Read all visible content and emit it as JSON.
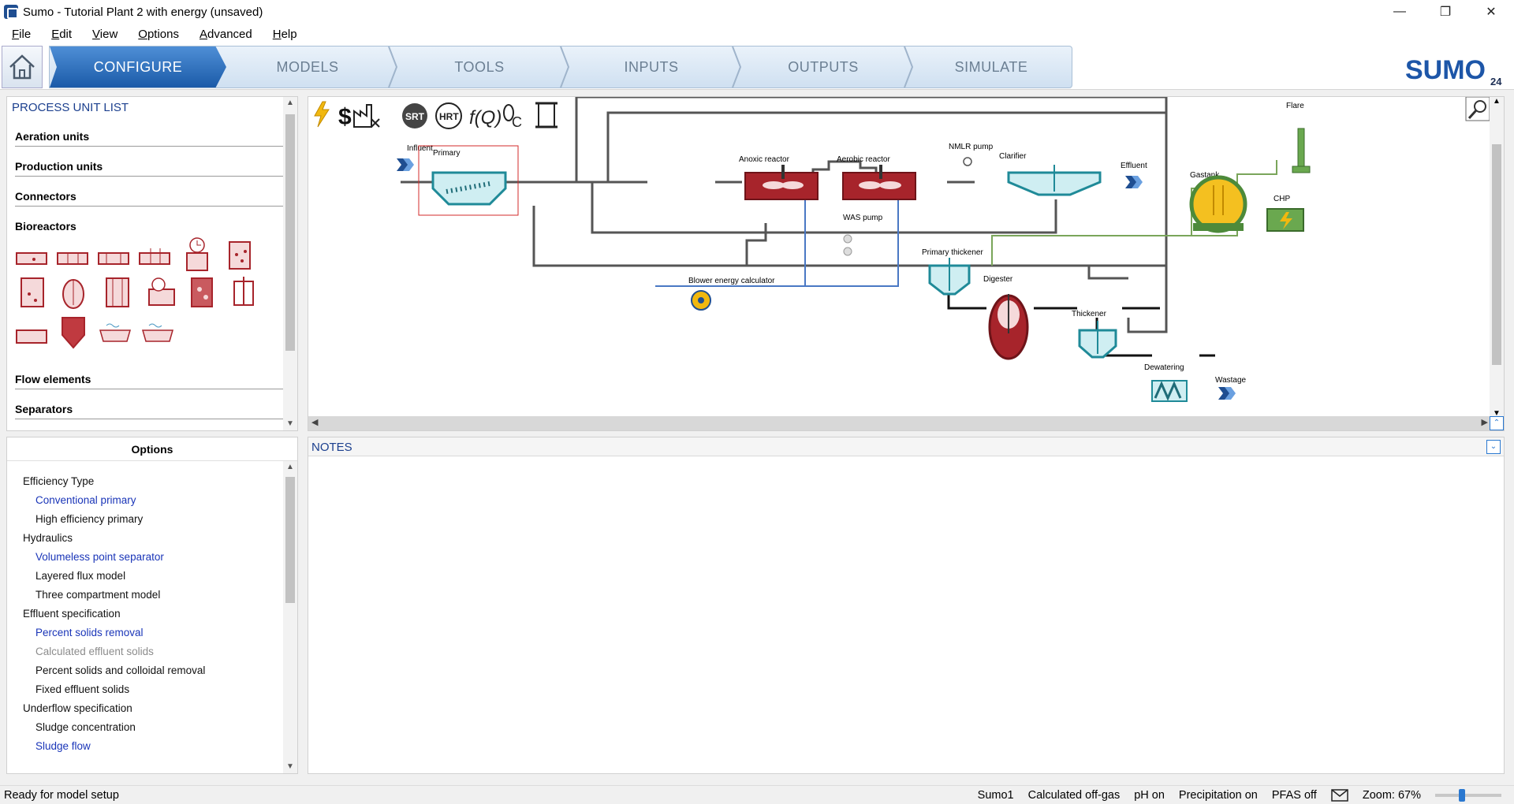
{
  "window": {
    "title": "Sumo - Tutorial Plant 2 with energy (unsaved)",
    "controls": [
      "—",
      "❐",
      "✕"
    ]
  },
  "menu": [
    "File",
    "Edit",
    "View",
    "Options",
    "Advanced",
    "Help"
  ],
  "tabs": [
    {
      "label": "CONFIGURE",
      "active": true
    },
    {
      "label": "MODELS",
      "active": false
    },
    {
      "label": "TOOLS",
      "active": false
    },
    {
      "label": "INPUTS",
      "active": false
    },
    {
      "label": "OUTPUTS",
      "active": false
    },
    {
      "label": "SIMULATE",
      "active": false
    }
  ],
  "logo": {
    "text": "SUMO",
    "version": "24"
  },
  "process_unit_list": {
    "title": "PROCESS UNIT LIST",
    "categories": [
      "Aeration units",
      "Production units",
      "Connectors",
      "Bioreactors",
      "Flow elements",
      "Separators"
    ]
  },
  "options": {
    "header": "Options",
    "items": [
      {
        "label": "Efficiency Type",
        "kind": "group"
      },
      {
        "label": "Conventional primary",
        "kind": "selected"
      },
      {
        "label": "High efficiency primary",
        "kind": "option"
      },
      {
        "label": "Hydraulics",
        "kind": "group"
      },
      {
        "label": "Volumeless point separator",
        "kind": "selected"
      },
      {
        "label": "Layered flux model",
        "kind": "option"
      },
      {
        "label": "Three compartment model",
        "kind": "option"
      },
      {
        "label": "Effluent specification",
        "kind": "group"
      },
      {
        "label": "Percent solids removal",
        "kind": "selected"
      },
      {
        "label": "Calculated effluent solids",
        "kind": "disabled"
      },
      {
        "label": "Percent solids and colloidal removal",
        "kind": "option"
      },
      {
        "label": "Fixed effluent solids",
        "kind": "option"
      },
      {
        "label": "Underflow specification",
        "kind": "group"
      },
      {
        "label": "Sludge concentration",
        "kind": "option"
      },
      {
        "label": "Sludge flow",
        "kind": "selected"
      }
    ]
  },
  "toolbar_icons": [
    "energy-icon",
    "cost-icon",
    "factory-icon",
    "srt-icon",
    "hrt-icon",
    "function-q-icon",
    "carbon-footprint-icon",
    "scroll-icon"
  ],
  "toolbar_labels": {
    "srt": "SRT",
    "hrt": "HRT"
  },
  "diagram": {
    "labels": {
      "influent": "Influent",
      "primary": "Primary",
      "anoxic": "Anoxic reactor",
      "aerobic": "Aerobic reactor",
      "nmlr_pump": "NMLR pump",
      "clarifier": "Clarifier",
      "effluent": "Effluent",
      "was_pump": "WAS pump",
      "blower": "Blower energy calculator",
      "primary_thickener": "Primary thickener",
      "digester": "Digester",
      "thickener": "Thickener",
      "dewatering": "Dewatering",
      "wastage": "Wastage",
      "flare": "Flare",
      "gastank": "Gastank",
      "chp": "CHP"
    }
  },
  "notes": {
    "title": "NOTES"
  },
  "status": {
    "left": "Ready for model setup",
    "items": [
      "Sumo1",
      "Calculated off-gas",
      "pH on",
      "Precipitation on",
      "PFAS off"
    ],
    "zoom": "Zoom: 67%",
    "zoom_level_percent": 67
  },
  "colors": {
    "accent": "#1b5aa8",
    "reactor_red": "#a7242b",
    "separator_teal": "#2a9aa8",
    "gas_yellow": "#f4c020",
    "gas_green": "#4d8a3a"
  }
}
